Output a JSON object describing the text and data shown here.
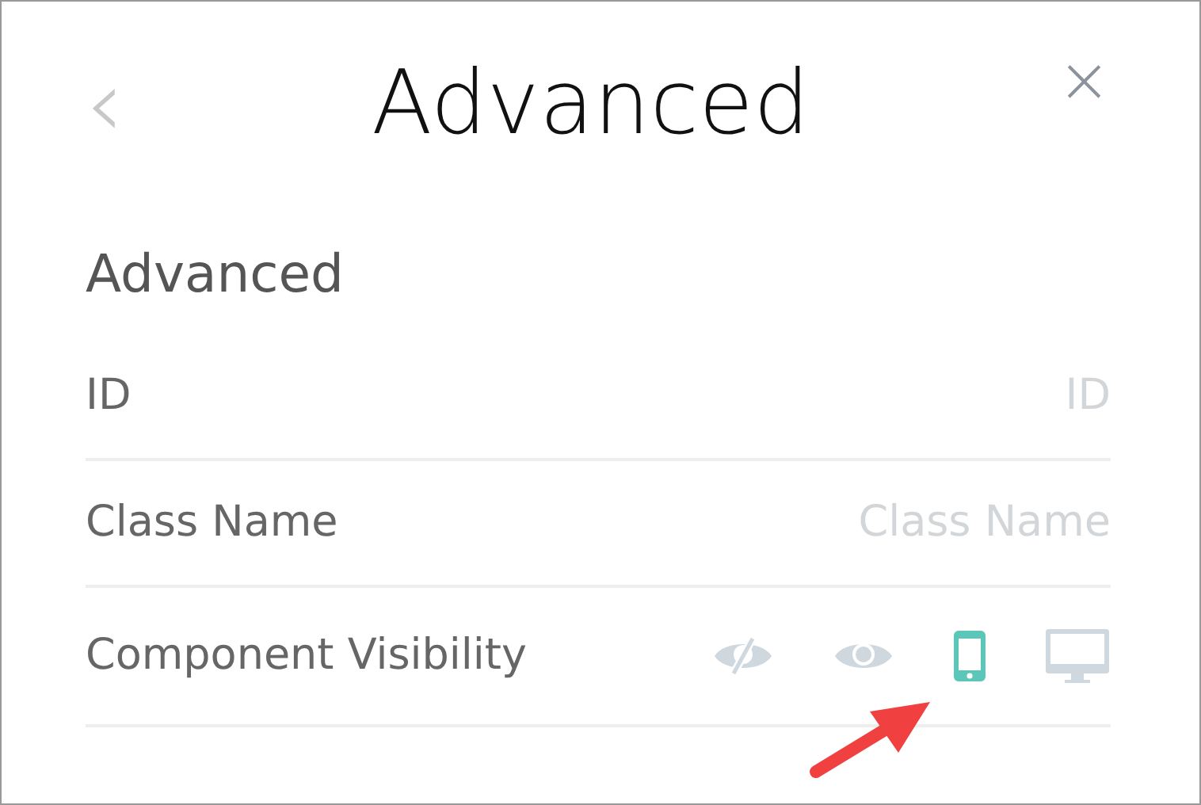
{
  "header": {
    "back": "‹",
    "title": "Advanced",
    "close": "×"
  },
  "section": {
    "title": "Advanced"
  },
  "fields": [
    {
      "label": "ID",
      "placeholder": "ID"
    },
    {
      "label": "Class Name",
      "placeholder": "Class Name"
    }
  ],
  "visibility": {
    "label": "Component Visibility",
    "options": [
      {
        "kind": "hidden",
        "selected": false
      },
      {
        "kind": "visible",
        "selected": false
      },
      {
        "kind": "mobile",
        "selected": true
      },
      {
        "kind": "desktop",
        "selected": false
      }
    ]
  }
}
